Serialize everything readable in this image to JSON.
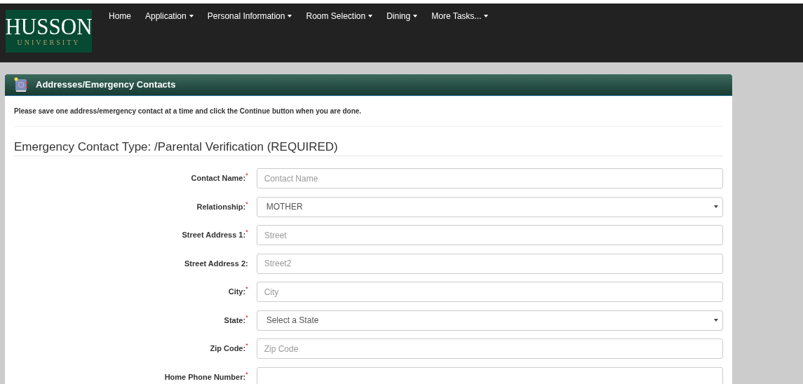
{
  "logo": {
    "name": "HUSSON",
    "subtitle": "UNIVERSITY"
  },
  "nav": [
    {
      "label": "Home",
      "caret": false
    },
    {
      "label": "Application",
      "caret": true
    },
    {
      "label": "Personal Information",
      "caret": true
    },
    {
      "label": "Room Selection",
      "caret": true
    },
    {
      "label": "Dining",
      "caret": true
    },
    {
      "label": "More Tasks...",
      "caret": true
    }
  ],
  "panel": {
    "title": "Addresses/Emergency Contacts",
    "instructions": "Please save one address/emergency contact at a time and click the Continue button when you are done.",
    "section_title": "Emergency Contact Type: /Parental Verification (REQUIRED)"
  },
  "fields": [
    {
      "kind": "input",
      "label": "Contact Name:",
      "required_mark": "*",
      "placeholder": "Contact Name"
    },
    {
      "kind": "select",
      "label": "Relationship:",
      "required_mark": "*",
      "value": "MOTHER"
    },
    {
      "kind": "input",
      "label": "Street Address 1:",
      "required_mark": "*",
      "placeholder": "Street"
    },
    {
      "kind": "input",
      "label": "Street Address 2:",
      "placeholder": "Street2"
    },
    {
      "kind": "input",
      "label": "City:",
      "required_mark": "*",
      "placeholder": "City"
    },
    {
      "kind": "select",
      "label": "State:",
      "required_mark": "*",
      "value": "Select a State"
    },
    {
      "kind": "input",
      "label": "Zip Code:",
      "required_mark": "*",
      "placeholder": "Zip Code"
    },
    {
      "kind": "input",
      "label": "Home Phone Number:",
      "required_mark": "*"
    }
  ]
}
